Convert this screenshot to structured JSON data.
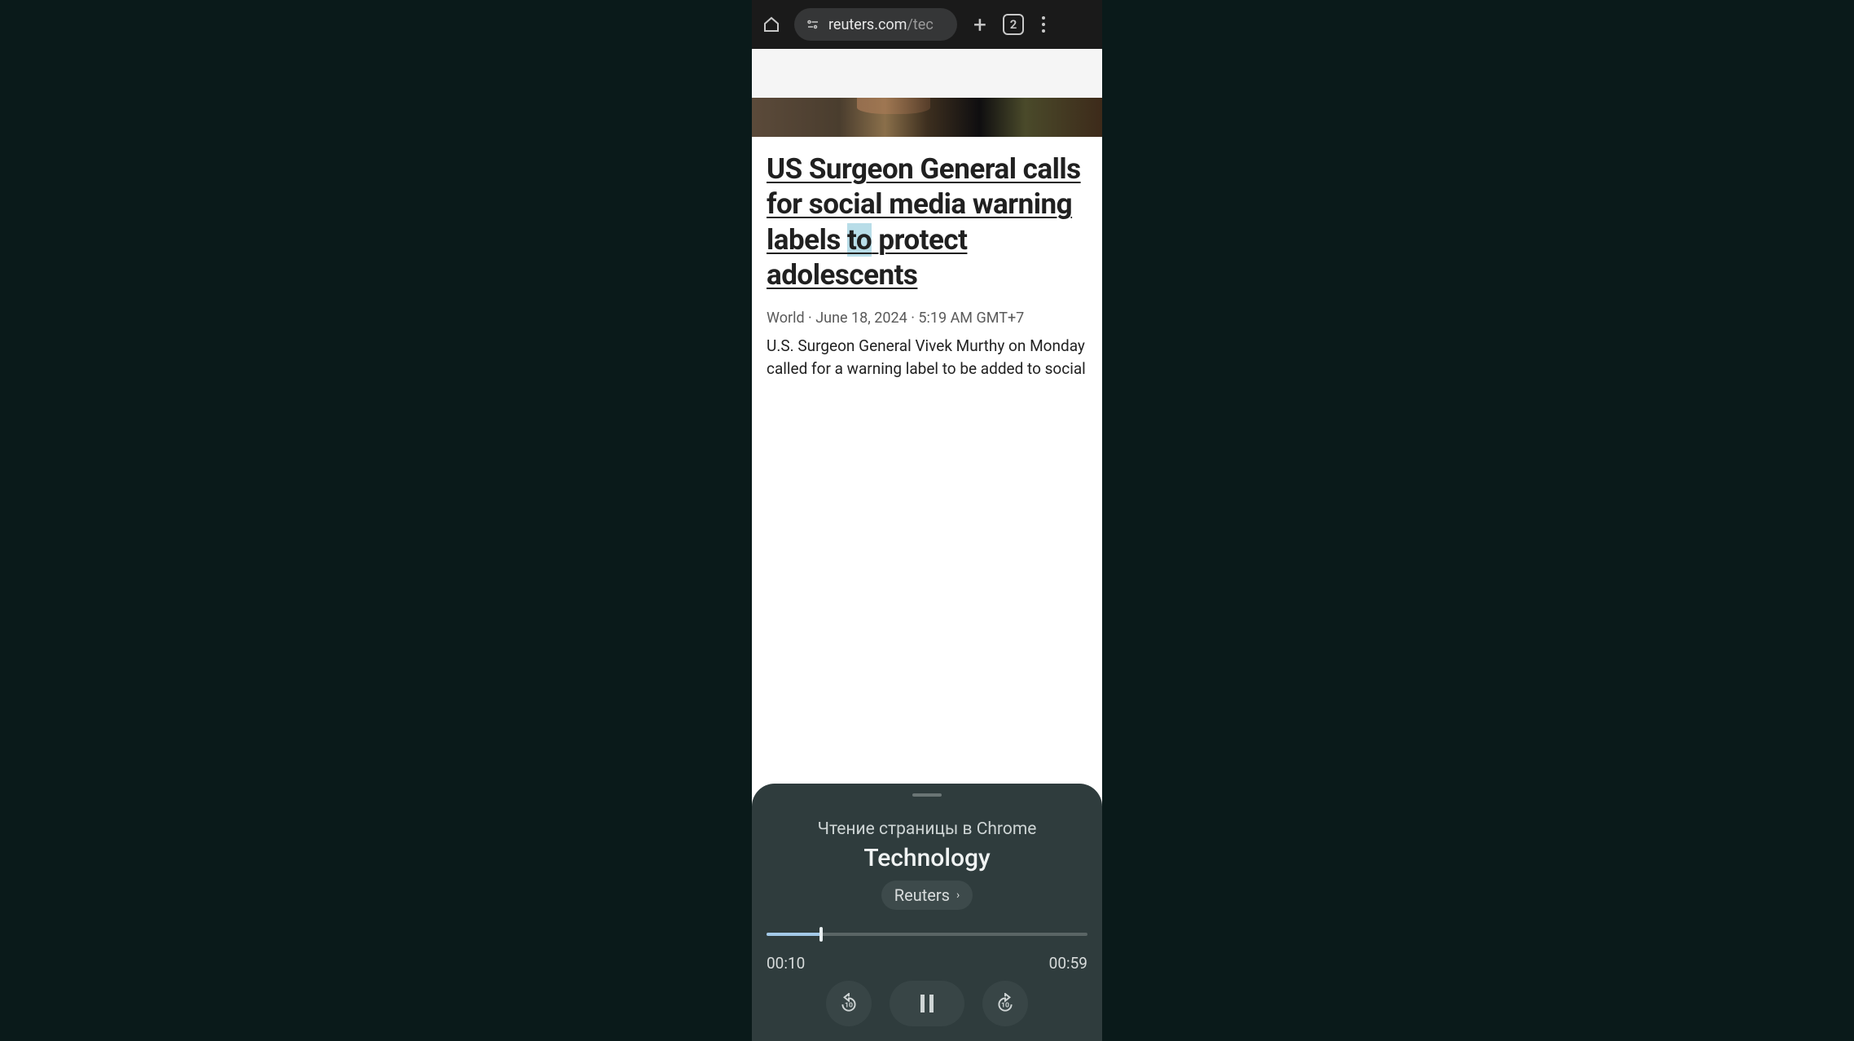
{
  "browser": {
    "url_domain": "reuters.com",
    "url_path": "/tec",
    "tab_count": "2"
  },
  "article": {
    "headline_pre": "US Surgeon General calls for social media warning labels ",
    "headline_highlight": "to",
    "headline_post": " protect adolescents",
    "meta_category": "World",
    "meta_date": "June 18, 2024",
    "meta_time": "5:19 AM GMT+7",
    "excerpt": "U.S. Surgeon General Vivek Murthy on Monday called for a warning label to be added to social"
  },
  "player": {
    "subtitle": "Чтение страницы в Chrome",
    "title": "Technology",
    "source": "Reuters",
    "time_current": "00:10",
    "time_total": "00:59",
    "progress_percent": 17
  }
}
